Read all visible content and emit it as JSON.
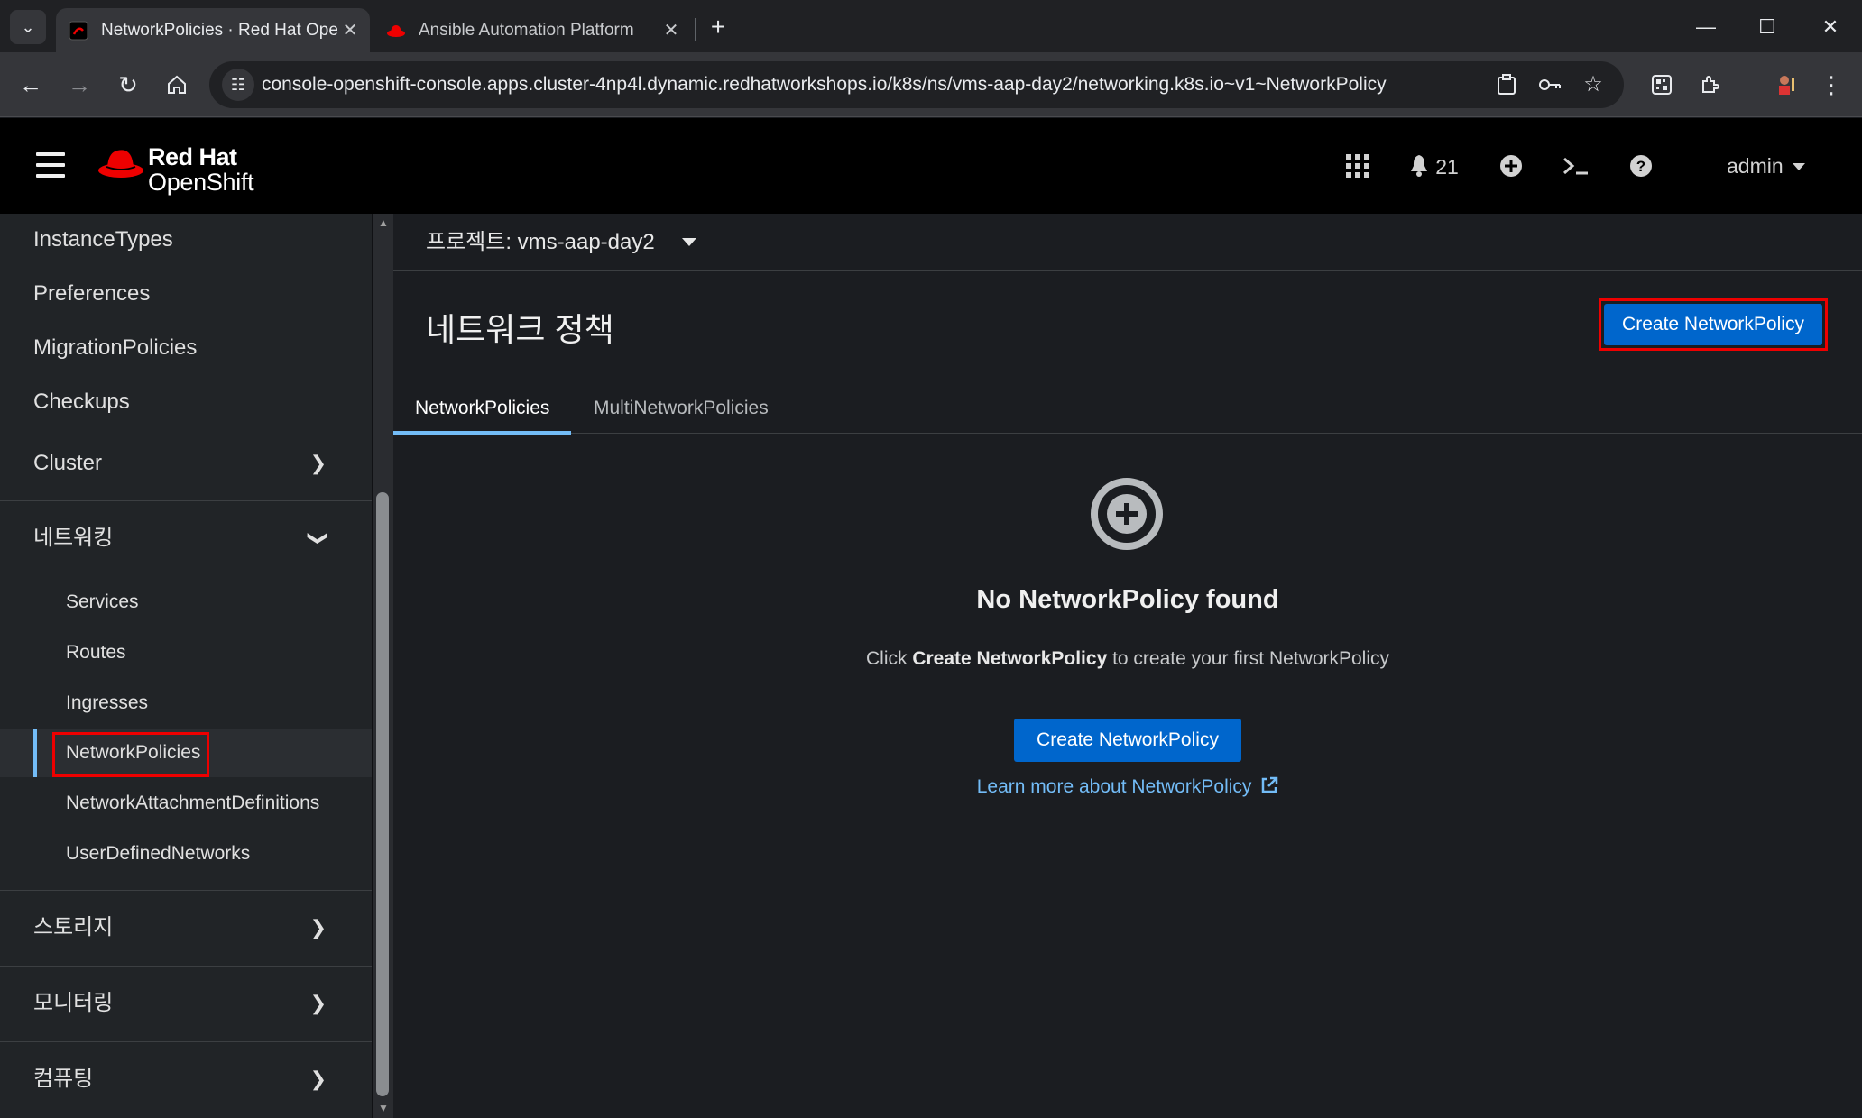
{
  "browser": {
    "tabs": [
      {
        "title": "NetworkPolicies · Red Hat Ope",
        "active": true
      },
      {
        "title": "Ansible Automation Platform",
        "active": false
      }
    ],
    "url": "console-openshift-console.apps.cluster-4np4l.dynamic.redhatworkshops.io/k8s/ns/vms-aap-day2/networking.k8s.io~v1~NetworkPolicy"
  },
  "masthead": {
    "brand_line1": "Red Hat",
    "brand_line2": "OpenShift",
    "notification_count": "21",
    "user": "admin"
  },
  "sidebar": {
    "items": [
      {
        "label": "InstanceTypes"
      },
      {
        "label": "Preferences"
      },
      {
        "label": "MigrationPolicies"
      },
      {
        "label": "Checkups"
      }
    ],
    "groups": {
      "cluster": "Cluster",
      "networking": "네트워킹",
      "storage": "스토리지",
      "monitoring": "모니터링",
      "compute": "컴퓨팅"
    },
    "networking_items": [
      {
        "label": "Services"
      },
      {
        "label": "Routes"
      },
      {
        "label": "Ingresses"
      },
      {
        "label": "NetworkPolicies"
      },
      {
        "label": "NetworkAttachmentDefinitions"
      },
      {
        "label": "UserDefinedNetworks"
      }
    ]
  },
  "main": {
    "project_label": "프로젝트: vms-aap-day2",
    "page_title": "네트워크 정책",
    "create_button": "Create NetworkPolicy",
    "tabs": [
      {
        "label": "NetworkPolicies",
        "active": true
      },
      {
        "label": "MultiNetworkPolicies",
        "active": false
      }
    ],
    "empty": {
      "title": "No NetworkPolicy found",
      "body_prefix": "Click ",
      "body_bold": "Create NetworkPolicy",
      "body_suffix": " to create your first NetworkPolicy",
      "button": "Create NetworkPolicy",
      "learn_more": "Learn more about NetworkPolicy"
    }
  },
  "colors": {
    "accent": "#0066cc",
    "link": "#73bcf7",
    "highlight": "#ee0000",
    "redhat_red": "#ee0000"
  }
}
